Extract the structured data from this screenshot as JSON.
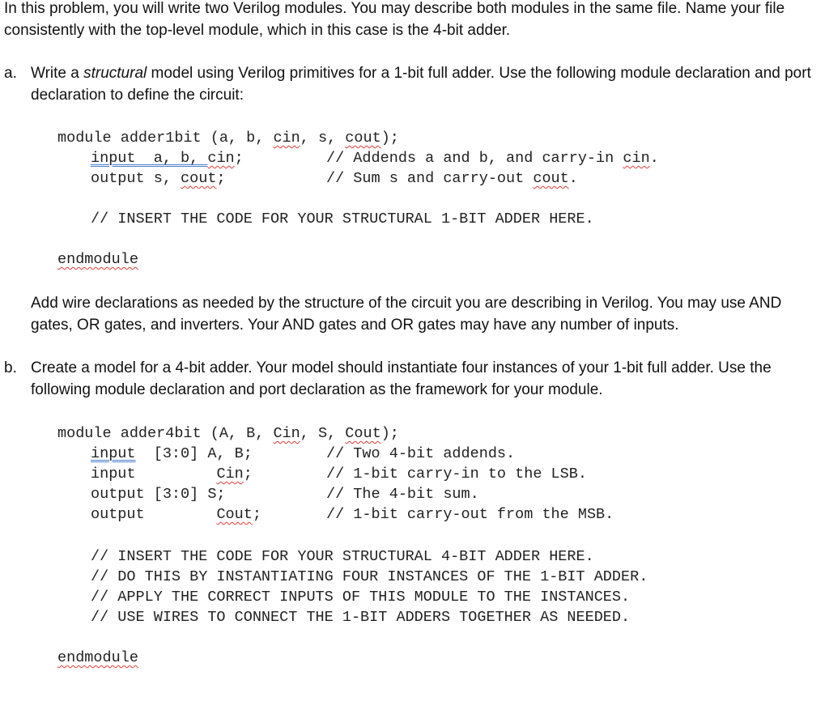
{
  "intro": {
    "text_before_em": "",
    "text": "In this problem, you will write two Verilog modules. You may describe both modules in the same file. Name your file consistently with the top-level module, which in this case is the 4-bit adder."
  },
  "part_a": {
    "marker": "a.",
    "text_pre": "Write a ",
    "text_em": "structural",
    "text_post": " model using Verilog primitives for a 1-bit full adder. Use the following module declaration and port declaration to define the circuit:",
    "code": {
      "module_line_pre": "module adder1bit (a, b, ",
      "module_cin": "cin",
      "module_mid": ", s, ",
      "module_cout": "cout",
      "module_end": ");",
      "input_kw": "input",
      "input_rest_pre": "  a, b, ",
      "input_cin": "cin",
      "input_end": ";",
      "output_pre": "output s, ",
      "output_cout": "cout",
      "output_end": ";",
      "comment1_pre": "// Addends a and b, and carry-in ",
      "comment1_cin": "cin",
      "comment1_end": ".",
      "comment2_pre": "// Sum s and carry-out ",
      "comment2_cout": "cout",
      "comment2_end": ".",
      "insert_comment": "// INSERT THE CODE FOR YOUR STRUCTURAL 1-BIT ADDER HERE.",
      "endmodule": "endmodule"
    },
    "note": "Add wire declarations as needed by the structure of the circuit you are describing in Verilog. You may use AND gates, OR gates, and inverters. Your AND gates and OR gates may have any number of inputs."
  },
  "part_b": {
    "marker": "b.",
    "text": "Create a model for a 4-bit adder. Your model should instantiate four instances of your 1-bit full adder. Use the following module declaration and port declaration as the framework for your module.",
    "code": {
      "module_line_pre": "module adder4bit (A, B, ",
      "module_cin": "Cin",
      "module_mid": ", S, ",
      "module_cout": "Cout",
      "module_end": ");",
      "line1_kw": "input",
      "line1_rest": "  [3:0] A, B;",
      "line1_comment": "// Two 4-bit addends.",
      "line2_kw": "input         ",
      "line2_cin": "Cin",
      "line2_end": ";",
      "line2_comment": "// 1-bit carry-in to the LSB.",
      "line3": "output [3:0] S;",
      "line3_comment": "// The 4-bit sum.",
      "line4_kw": "output        ",
      "line4_cout": "Cout",
      "line4_end": ";",
      "line4_comment": "// 1-bit carry-out from the MSB.",
      "insert_comments": [
        "// INSERT THE CODE FOR YOUR STRUCTURAL 4-BIT ADDER HERE.",
        "// DO THIS BY INSTANTIATING FOUR INSTANCES OF THE 1-BIT ADDER.",
        "// APPLY THE CORRECT INPUTS OF THIS MODULE TO THE INSTANCES.",
        "// USE WIRES TO CONNECT THE 1-BIT ADDERS TOGETHER AS NEEDED."
      ],
      "endmodule": "endmodule"
    }
  }
}
